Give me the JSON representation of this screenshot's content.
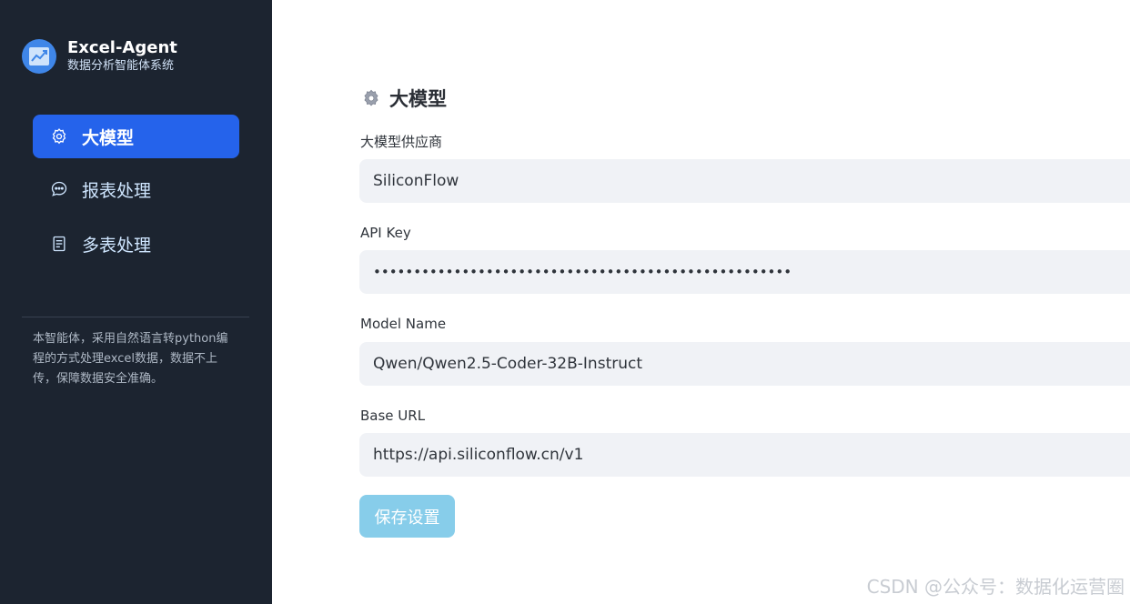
{
  "sidebar": {
    "brand": {
      "title": "Excel-Agent",
      "subtitle": "数据分析智能体系统",
      "icon": "chart-logo-icon"
    },
    "nav": [
      {
        "label": "大模型",
        "icon": "gear-icon",
        "active": true
      },
      {
        "label": "报表处理",
        "icon": "chat-bubble-icon",
        "active": false
      },
      {
        "label": "多表处理",
        "icon": "document-icon",
        "active": false
      }
    ],
    "description": "本智能体，采用自然语言转python编程的方式处理excel数据，数据不上传，保障数据安全准确。"
  },
  "main": {
    "title": "大模型",
    "title_icon": "gear-icon",
    "fields": [
      {
        "label": "大模型供应商",
        "value": "SiliconFlow",
        "type": "text"
      },
      {
        "label": "API Key",
        "value": "••••••••••••••••••••••••••••••••••••••••••••••••••••",
        "type": "password"
      },
      {
        "label": "Model Name",
        "value": "Qwen/Qwen2.5-Coder-32B-Instruct",
        "type": "text"
      },
      {
        "label": "Base URL",
        "value": "https://api.siliconflow.cn/v1",
        "type": "text"
      }
    ],
    "save_label": "保存设置"
  },
  "watermark": "CSDN @公众号：数据化运营圈",
  "colors": {
    "sidebar_bg": "#1c2430",
    "active_nav": "#2563eb",
    "input_bg": "#f0f2f6",
    "save_button": "#87cdea"
  }
}
